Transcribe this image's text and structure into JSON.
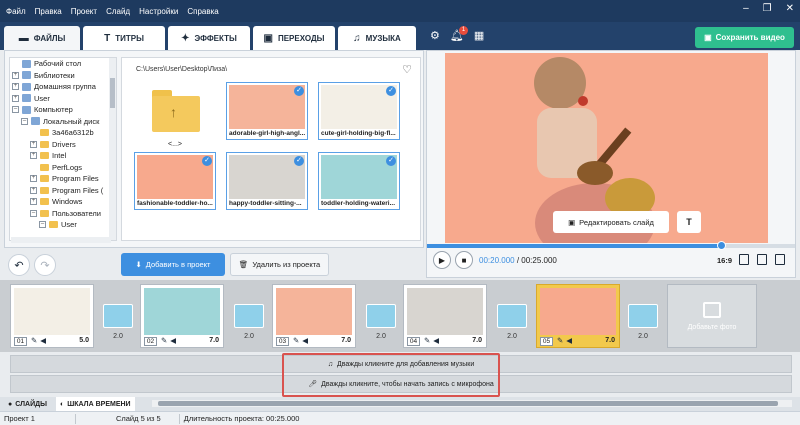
{
  "menu": [
    "Файл",
    "Правка",
    "Проект",
    "Слайд",
    "Настройки",
    "Справка"
  ],
  "window_controls": [
    "–",
    "❐",
    "✕"
  ],
  "tabs": [
    {
      "label": "ФАЙЛЫ",
      "icon": "folder-icon"
    },
    {
      "label": "ТИТРЫ",
      "icon": "text-icon"
    },
    {
      "label": "ЭФФЕКТЫ",
      "icon": "effects-icon"
    },
    {
      "label": "ПЕРЕХОДЫ",
      "icon": "transitions-icon"
    },
    {
      "label": "МУЗЫКА",
      "icon": "music-icon"
    }
  ],
  "top_icons": [
    "gear-icon",
    "bell-icon",
    "gallery-icon"
  ],
  "notification_count": "1",
  "save_button": "Сохранить видео",
  "tree": [
    {
      "label": "Рабочий стол",
      "depth": 0,
      "exp": ""
    },
    {
      "label": "Библиотеки",
      "depth": 0,
      "exp": "+"
    },
    {
      "label": "Домашняя группа",
      "depth": 0,
      "exp": "+"
    },
    {
      "label": "User",
      "depth": 0,
      "exp": "+"
    },
    {
      "label": "Компьютер",
      "depth": 0,
      "exp": "–"
    },
    {
      "label": "Локальный диск",
      "depth": 1,
      "exp": "–"
    },
    {
      "label": "3a46a6312b",
      "depth": 2,
      "exp": ""
    },
    {
      "label": "Drivers",
      "depth": 2,
      "exp": "+"
    },
    {
      "label": "Intel",
      "depth": 2,
      "exp": "+"
    },
    {
      "label": "PerfLogs",
      "depth": 2,
      "exp": ""
    },
    {
      "label": "Program Files",
      "depth": 2,
      "exp": "+"
    },
    {
      "label": "Program Files (",
      "depth": 2,
      "exp": "+"
    },
    {
      "label": "Windows",
      "depth": 2,
      "exp": "+"
    },
    {
      "label": "Пользователи",
      "depth": 2,
      "exp": "–"
    },
    {
      "label": "User",
      "depth": 3,
      "exp": "–"
    }
  ],
  "path": "C:\\Users\\User\\Desktop\\Лиза\\",
  "folder_label": "<...>",
  "files": [
    {
      "name": "adorable-girl-high-angl...",
      "bg": "#f5b49a"
    },
    {
      "name": "cute-girl-holding-big-fl...",
      "bg": "#f3efe6"
    },
    {
      "name": "fashionable-toddler-ho...",
      "bg": "#f7a98d"
    },
    {
      "name": "happy-toddler-sitting-...",
      "bg": "#d8d5d0"
    },
    {
      "name": "toddler-holding-wateri...",
      "bg": "#9fd6d8"
    }
  ],
  "add_to_project": "Добавить в проект",
  "remove_from_project": "Удалить из проекта",
  "edit_slide": "Редактировать слайд",
  "text_button": "T",
  "time_current": "00:20.000",
  "time_total": "/ 00:25.000",
  "progress": 0.8,
  "aspect": "16:9",
  "slides": [
    {
      "num": "01",
      "dur": "5.0",
      "bg": "#f3efe6"
    },
    {
      "num": "02",
      "dur": "7.0",
      "bg": "#9fd6d8"
    },
    {
      "num": "03",
      "dur": "7.0",
      "bg": "#f5b49a"
    },
    {
      "num": "04",
      "dur": "7.0",
      "bg": "#d8d5d0"
    },
    {
      "num": "05",
      "dur": "7.0",
      "bg": "#f7a98d"
    }
  ],
  "transitions": [
    "2.0",
    "2.0",
    "2.0",
    "2.0",
    "2.0"
  ],
  "add_photo": "Добавьте фото",
  "music_row": "Дважды кликните для добавления музыки",
  "mic_row": "Дважды кликните, чтобы начать запись с микрофона",
  "bottom_tabs": [
    "СЛАЙДЫ",
    "ШКАЛА ВРЕМЕНИ"
  ],
  "status": {
    "project": "Проект 1",
    "slide": "Слайд 5 из 5",
    "duration": "Длительность проекта: 00:25.000"
  }
}
